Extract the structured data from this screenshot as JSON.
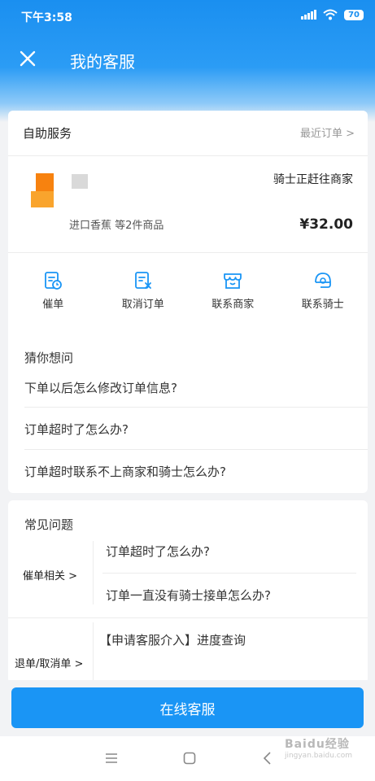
{
  "status_bar": {
    "time": "下午3:58",
    "battery": "70"
  },
  "nav": {
    "title": "我的客服"
  },
  "self_service": {
    "label": "自助服务",
    "recent_orders_link": "最近订单 >"
  },
  "order": {
    "status": "骑士正赶往商家",
    "items": "进口香蕉 等2件商品",
    "price": "¥32.00"
  },
  "actions": [
    {
      "label": "催单",
      "icon": "urge-order-icon"
    },
    {
      "label": "取消订单",
      "icon": "cancel-order-icon"
    },
    {
      "label": "联系商家",
      "icon": "contact-merchant-icon"
    },
    {
      "label": "联系骑士",
      "icon": "contact-rider-icon"
    }
  ],
  "guess": {
    "title": "猜你想问",
    "questions": [
      "下单以后怎么修改订单信息?",
      "订单超时了怎么办?",
      "订单超时联系不上商家和骑士怎么办?"
    ]
  },
  "faq": {
    "title": "常见问题",
    "categories": [
      {
        "label": "催单相关 >",
        "questions": [
          "订单超时了怎么办?",
          "订单一直没有骑士接单怎么办?"
        ]
      },
      {
        "label": "退单/取消单 >",
        "questions": [
          "【申请客服介入】进度查询"
        ]
      }
    ]
  },
  "cta": {
    "label": "在线客服"
  },
  "watermark": {
    "text": "Baidu经验",
    "sub": "jingyan.baidu.com"
  },
  "colors": {
    "primary": "#1a95f5",
    "header": "#1a8ff0",
    "price": "#222222"
  }
}
